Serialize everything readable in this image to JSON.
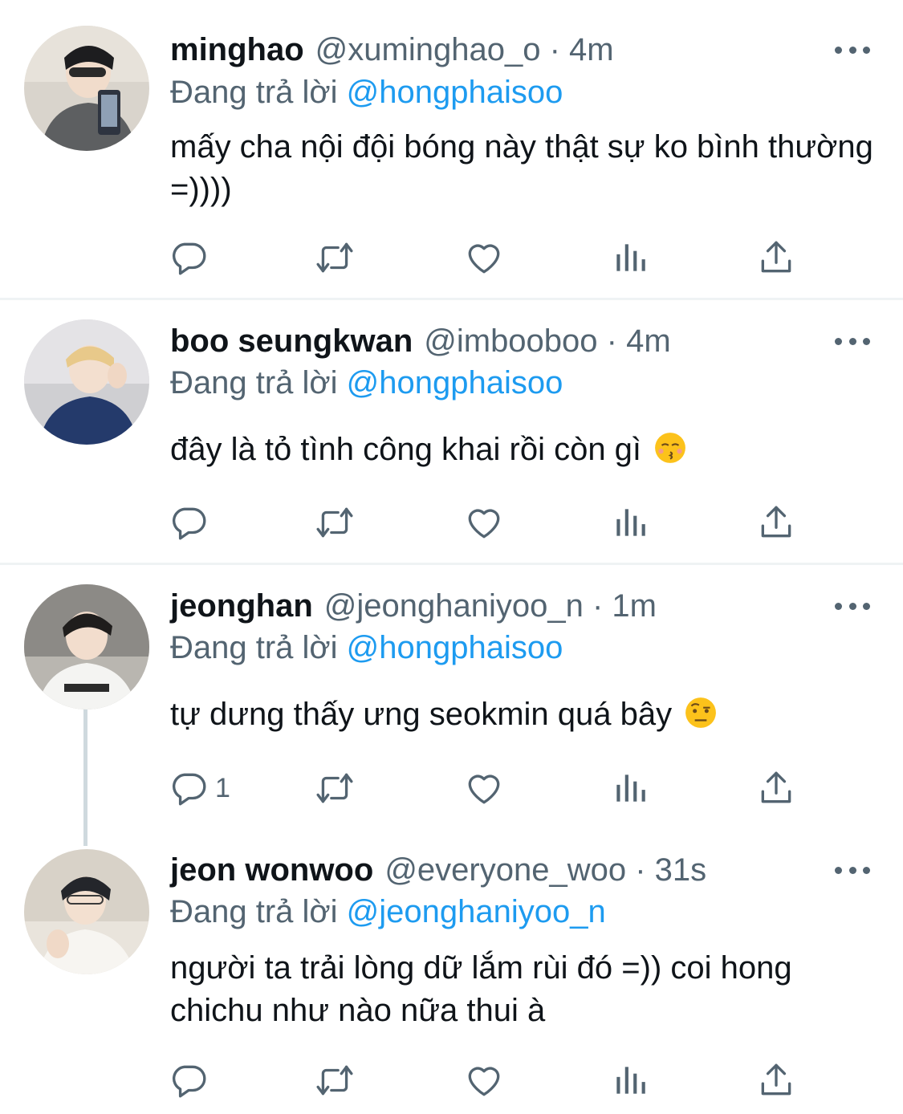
{
  "tweets": [
    {
      "name": "minghao",
      "handle": "@xuminghao_o",
      "time": "4m",
      "replying_label": "Đang trả lời",
      "replying_to": "@hongphaisoo",
      "text": "mấy cha nội đội bóng này thật sự ko bình thường =))))",
      "reply_count": ""
    },
    {
      "name": "boo seungkwan",
      "handle": "@imbooboo",
      "time": "4m",
      "replying_label": "Đang trả lời",
      "replying_to": "@hongphaisoo",
      "text": "đây là tỏ tình công khai rồi còn gì",
      "emoji": "kissing-face-closed-eyes",
      "reply_count": ""
    },
    {
      "name": "jeonghan",
      "handle": "@jeonghaniyoo_n",
      "time": "1m",
      "replying_label": "Đang trả lời",
      "replying_to": "@hongphaisoo",
      "text": "tự dưng thấy ưng seokmin quá bây",
      "emoji": "face-with-raised-eyebrow",
      "reply_count": "1"
    },
    {
      "name": "jeon wonwoo",
      "handle": "@everyone_woo",
      "time": "31s",
      "replying_label": "Đang trả lời",
      "replying_to": "@jeonghaniyoo_n",
      "text": "người ta trải lòng dữ lắm rùi đó =)) coi hong chichu như nào nữa thui à",
      "reply_count": ""
    }
  ],
  "separator": " · ",
  "icons": [
    "reply-icon",
    "retweet-icon",
    "like-icon",
    "analytics-icon",
    "share-icon",
    "more-icon"
  ],
  "colors": {
    "link": "#1d9bf0",
    "secondary": "#536471",
    "text": "#0f1419",
    "divider": "#eff3f4"
  }
}
